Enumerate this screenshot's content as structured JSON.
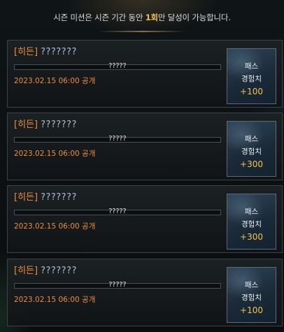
{
  "header": {
    "text_before": "시즌 미션은 시즌 기간 동안 ",
    "highlight": "1회",
    "text_after": "만 달성이 가능합니다."
  },
  "missions": [
    {
      "tag": "[히든]",
      "name": "???????",
      "progress_text": "?????",
      "progress_fraction": 0,
      "date": "2023.02.15 06:00 공개",
      "reward_line1": "패스",
      "reward_line2": "경험치",
      "reward_value": "+100"
    },
    {
      "tag": "[히든]",
      "name": "???????",
      "progress_text": "?????",
      "progress_fraction": 0,
      "date": "2023.02.15 06:00 공개",
      "reward_line1": "패스",
      "reward_line2": "경험치",
      "reward_value": "+300"
    },
    {
      "tag": "[히든]",
      "name": "???????",
      "progress_text": "?????",
      "progress_fraction": 0,
      "date": "2023.02.15 06:00 공개",
      "reward_line1": "패스",
      "reward_line2": "경험치",
      "reward_value": "+300"
    },
    {
      "tag": "[히든]",
      "name": "???????",
      "progress_text": "?????",
      "progress_fraction": 0,
      "date": "2023.02.15 06:00 공개",
      "reward_line1": "패스",
      "reward_line2": "경험치",
      "reward_value": "+100"
    }
  ],
  "colors": {
    "accent_orange": "#ef8c3a",
    "accent_gold": "#f2c14a",
    "mission_name": "#aebdcc"
  }
}
